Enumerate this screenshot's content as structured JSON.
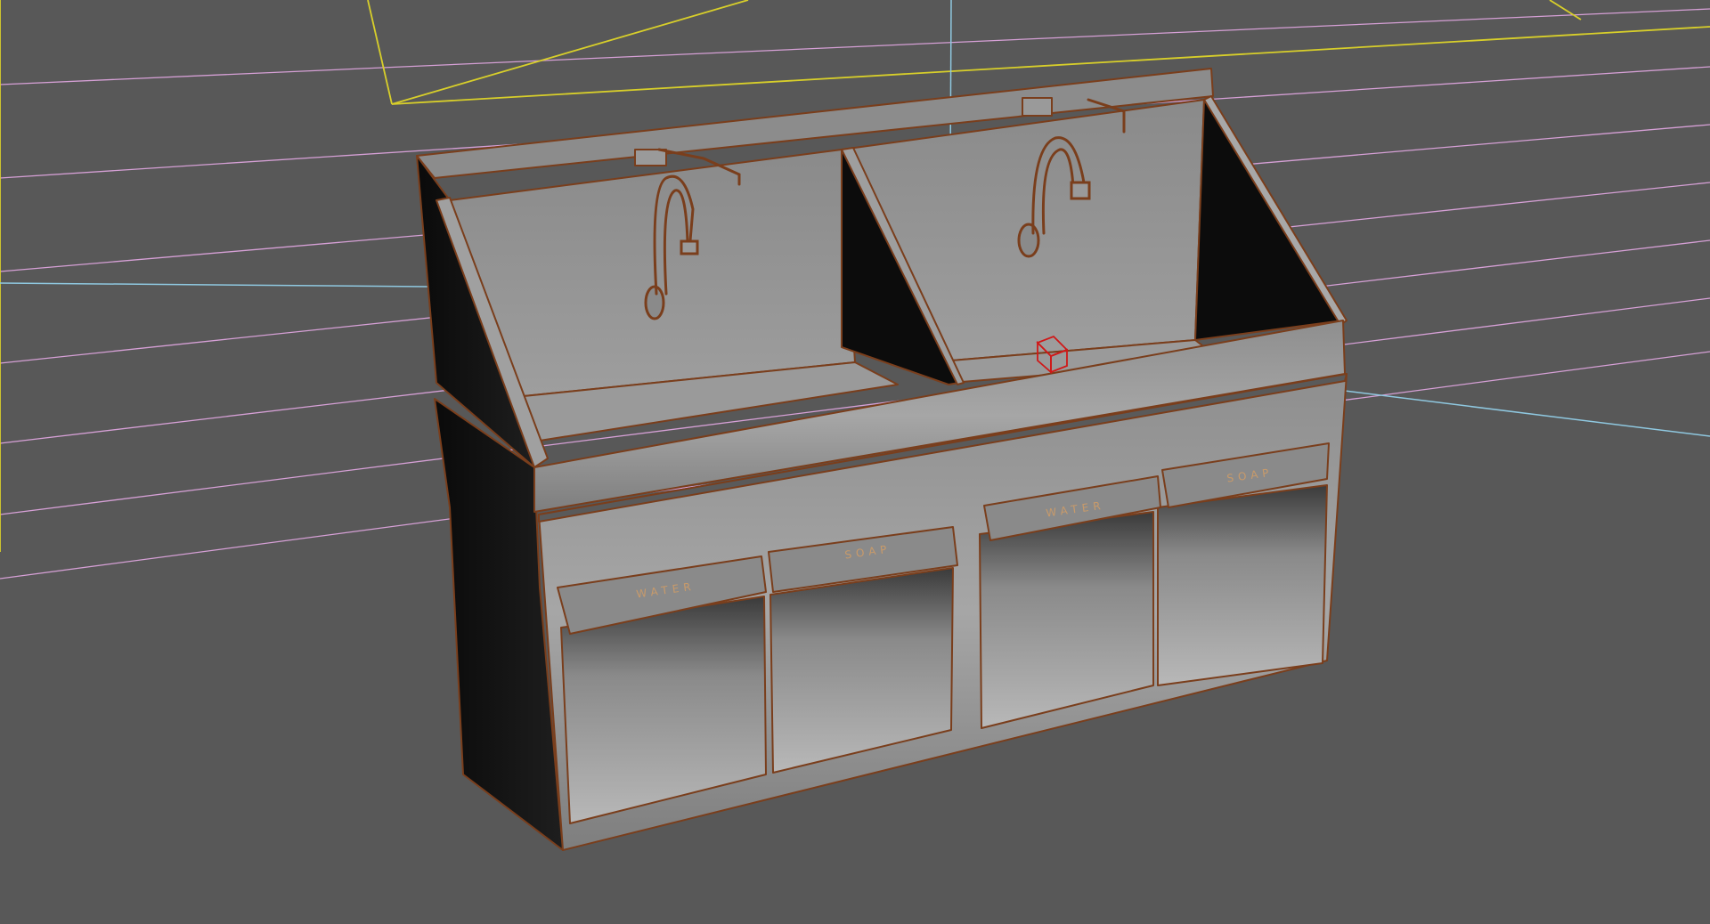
{
  "viewport": {
    "background": "#585858",
    "grid_color": "#d6a0d6",
    "axis_color": "#8fc8e0",
    "camera_color": "#d8cf2a",
    "wire_color": "#7a3e1c",
    "pivot_color": "#d01818"
  },
  "sink": {
    "labels": {
      "left_water": "WATER",
      "left_soap": "SOAP",
      "right_water": "WATER",
      "right_soap": "SOAP"
    }
  }
}
